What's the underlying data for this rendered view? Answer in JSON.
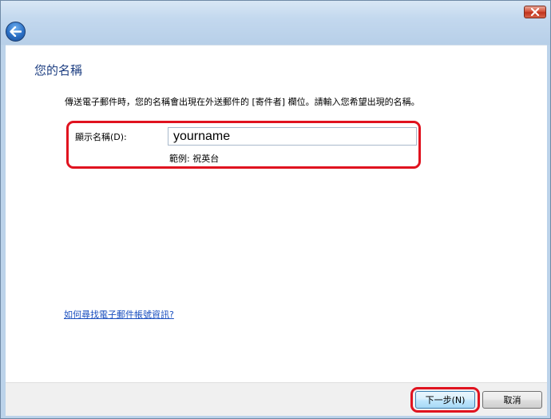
{
  "window": {
    "close_icon": "close-icon",
    "back_icon": "back-arrow-icon"
  },
  "page": {
    "title": "您的名稱",
    "intro": "傳送電子郵件時，您的名稱會出現在外送郵件的 [寄件者] 欄位。請輸入您希望出現的名稱。",
    "display_name_label": "顯示名稱(D):",
    "display_name_value": "yourname",
    "example": "範例: 祝英台",
    "help_link": "如何尋找電子郵件帳號資訊?"
  },
  "footer": {
    "next_label": "下一步(N)",
    "cancel_label": "取消"
  },
  "colors": {
    "highlight": "#e0131f",
    "title_text": "#1e3f82",
    "link": "#1a4fbf"
  }
}
